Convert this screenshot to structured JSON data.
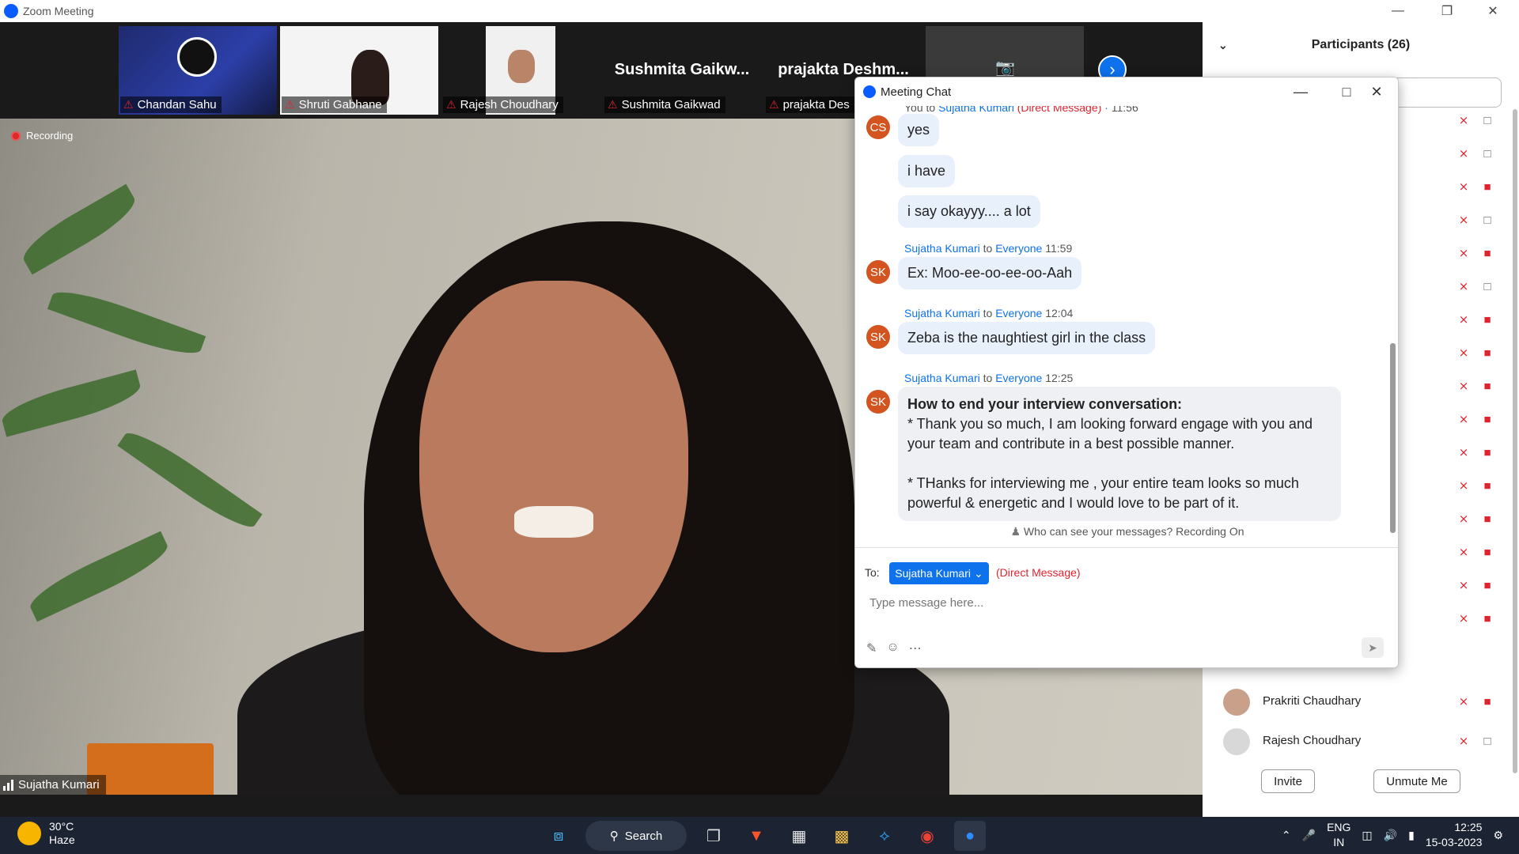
{
  "window": {
    "title": "Zoom Meeting"
  },
  "strip": {
    "tiles": [
      {
        "name": "Chandan Sahu"
      },
      {
        "name": "Shruti Gabhane"
      },
      {
        "name": "Rajesh Choudhary"
      },
      {
        "name": "Sushmita Gaikwad",
        "big": "Sushmita  Gaikw..."
      },
      {
        "name": "prajakta Des",
        "big": "prajakta  Deshm..."
      }
    ]
  },
  "main": {
    "recording": "Recording",
    "speaker": "Sujatha Kumari"
  },
  "participants": {
    "header": "Participants (26)",
    "rows": [
      {
        "name": "Prakriti Chaudhary"
      },
      {
        "name": "Rajesh Choudhary"
      }
    ],
    "invite": "Invite",
    "unmute": "Unmute Me"
  },
  "chat": {
    "title": "Meeting Chat",
    "top_sender": {
      "from": "You",
      "to": "Sujatha Kumari",
      "dm": "(Direct Message)",
      "time": "11:56"
    },
    "you_avatar": "CS",
    "you_msgs": [
      "yes",
      "i have",
      "i say okayyy.... a lot"
    ],
    "messages": [
      {
        "avatar": "SK",
        "from": "Sujatha Kumari",
        "to": "Everyone",
        "time": "11:59",
        "text": "Ex: Moo-ee-oo-ee-oo-Aah"
      },
      {
        "avatar": "SK",
        "from": "Sujatha Kumari",
        "to": "Everyone",
        "time": "12:04",
        "text": "Zeba is the naughtiest girl in the class"
      },
      {
        "avatar": "SK",
        "from": "Sujatha Kumari",
        "to": "Everyone",
        "time": "12:25",
        "heading": "How to end your interview conversation:",
        "line1": "* Thank you so much, I am looking forward engage with you and your team and contribute in a best possible manner.",
        "line2": "* THanks for interviewing me , your entire team looks so much powerful & energetic and I would love to be part of it."
      }
    ],
    "to_word": "to",
    "notice": "Who can see your messages? Recording On",
    "to_label": "To:",
    "recipient": "Sujatha Kumari",
    "dm_tag": "(Direct Message)",
    "placeholder": "Type message here..."
  },
  "taskbar": {
    "temp": "30°C",
    "weather": "Haze",
    "search": "Search",
    "lang1": "ENG",
    "lang2": "IN",
    "time": "12:25",
    "date": "15-03-2023"
  }
}
